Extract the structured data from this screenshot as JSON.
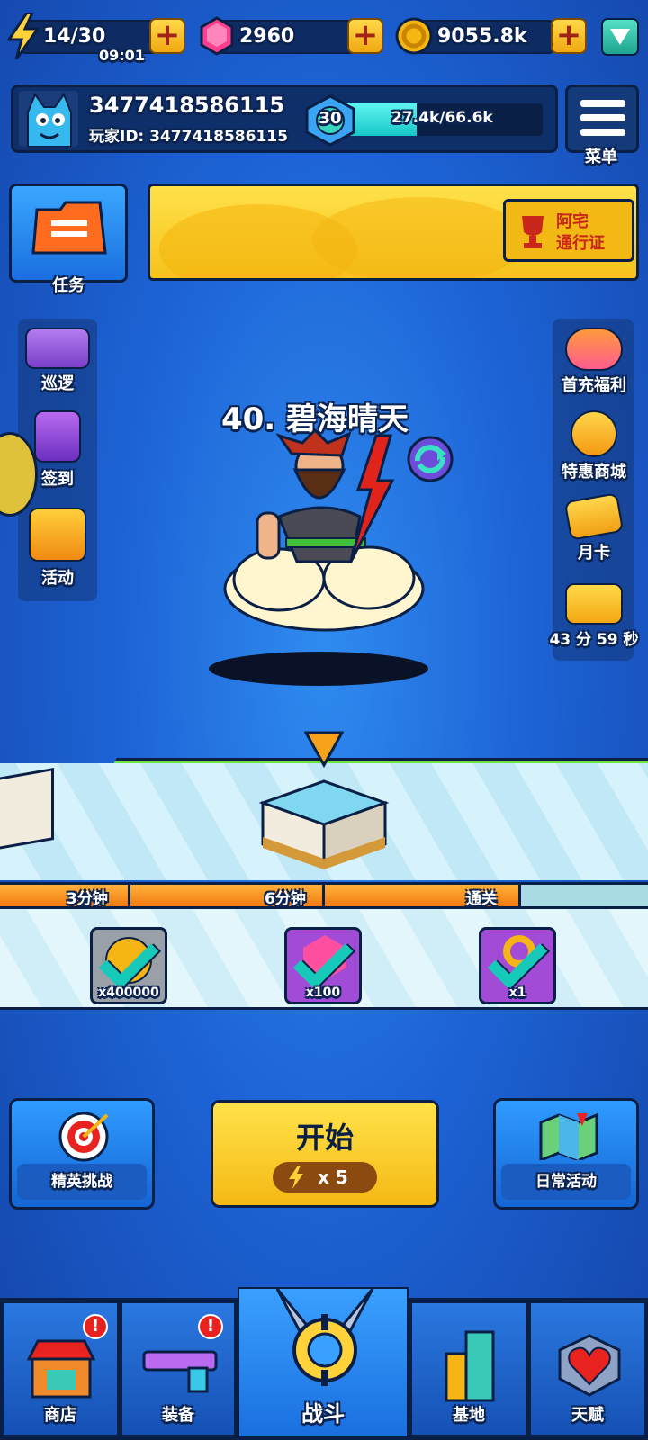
{
  "top": {
    "energy": "14/30",
    "timer": "09:01",
    "gems": "2960",
    "coins": "9055.8k"
  },
  "profile": {
    "name": "3477418586115",
    "player_id": "玩家ID: 3477418586115",
    "level": "30",
    "xp": "27.4k/66.6k",
    "xp_fraction": 0.41,
    "menu_label": "菜单"
  },
  "quest": {
    "label": "任务"
  },
  "banner": {
    "label_line1": "阿宅",
    "label_line2": "通行证"
  },
  "left_side": [
    {
      "label": "巡逻",
      "icon": "truck-icon"
    },
    {
      "label": "签到",
      "icon": "scroll-icon"
    },
    {
      "label": "活动",
      "icon": "megaphone-icon"
    }
  ],
  "right_side": [
    {
      "label": "首充福利",
      "icon": "gift-girl-icon"
    },
    {
      "label": "特惠商城",
      "icon": "shop-bag-icon"
    },
    {
      "label": "月卡",
      "icon": "card-icon"
    },
    {
      "label": "43 分 59 秒",
      "icon": "chest-icon"
    }
  ],
  "stage": {
    "title": "40. 碧海晴天"
  },
  "milestones": [
    "3分钟",
    "6分钟",
    "通关"
  ],
  "rewards": [
    {
      "qty": "x400000",
      "icon": "coin-icon",
      "color": "#9aa0a8"
    },
    {
      "qty": "x100",
      "icon": "gem-icon",
      "color": "#a24bd6"
    },
    {
      "qty": "x1",
      "icon": "key-icon",
      "color": "#a24bd6"
    }
  ],
  "actions": {
    "elite": "精英挑战",
    "start": "开始",
    "start_cost": "x 5",
    "daily": "日常活动"
  },
  "nav": [
    {
      "label": "商店",
      "badge": "!"
    },
    {
      "label": "装备",
      "badge": "!"
    },
    {
      "label": "战斗"
    },
    {
      "label": "基地"
    },
    {
      "label": "天赋"
    }
  ]
}
